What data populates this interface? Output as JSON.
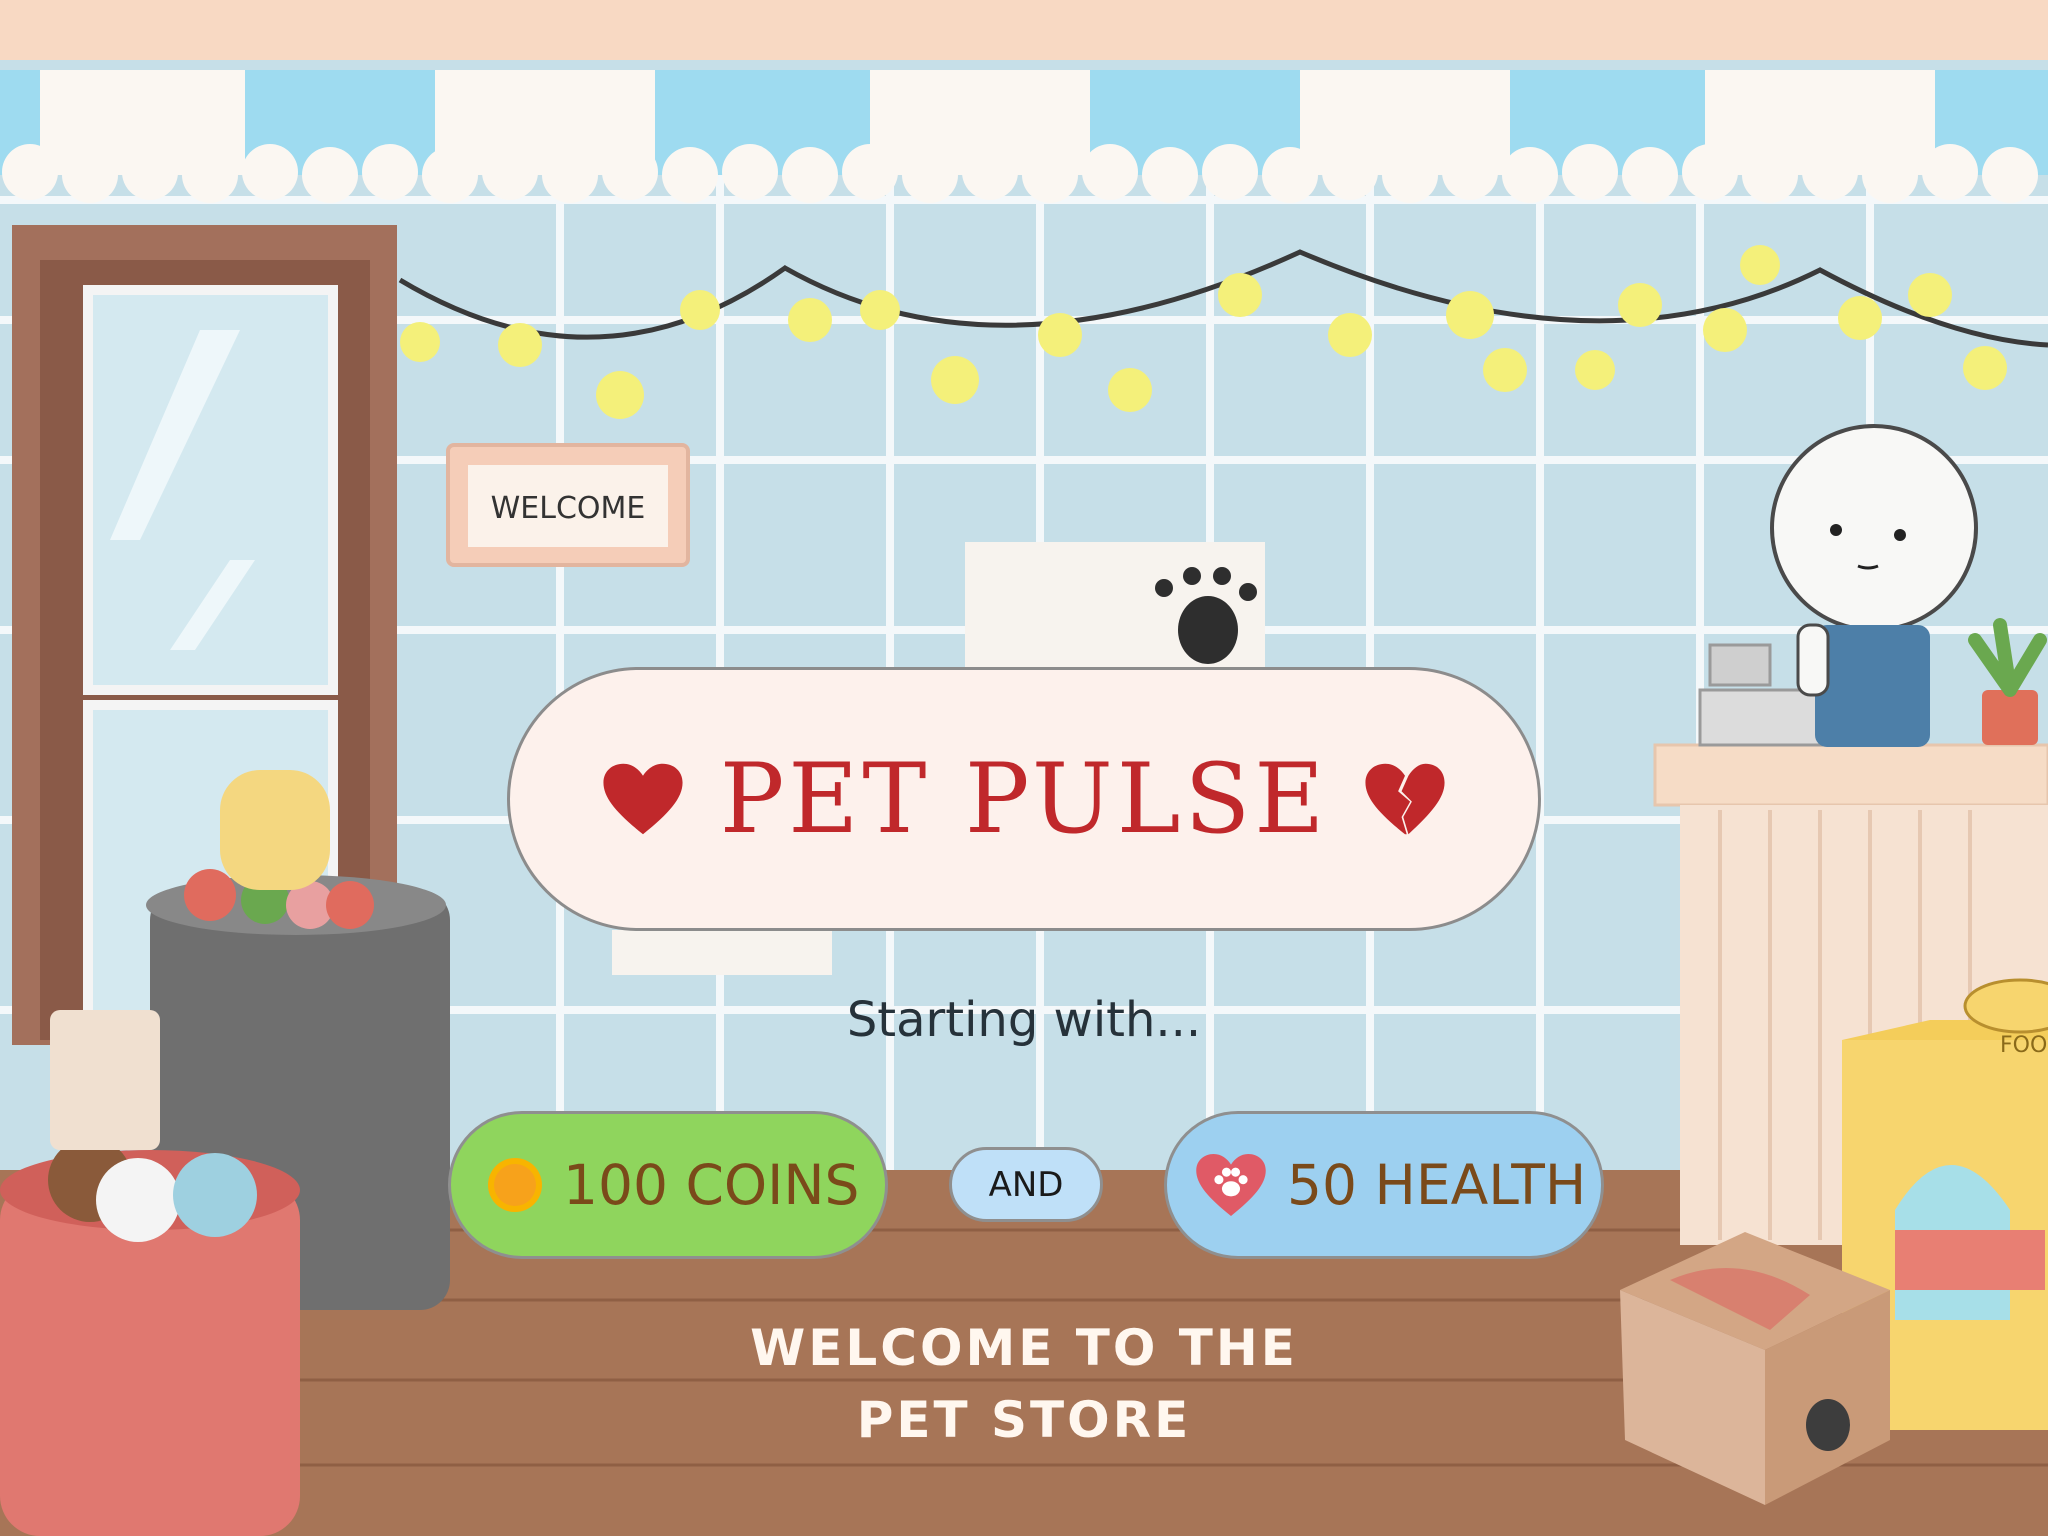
{
  "title": "PET PULSE",
  "subtitle": "Starting with...",
  "coins_label": "100 COINS",
  "and_label": "AND",
  "health_label": "50 HEALTH",
  "welcome_line1": "WELCOME TO THE",
  "welcome_line2": "PET STORE",
  "sign_text": "WELCOME",
  "food_text": "FOOD",
  "icons": [
    "heart-icon",
    "broken-heart-icon",
    "coin-icon",
    "paw-heart-icon"
  ],
  "colors": {
    "title": "#c0282b",
    "coins_pill": "#8fd55d",
    "health_pill": "#9dd0f0",
    "and_pill": "#bfe0f8"
  }
}
